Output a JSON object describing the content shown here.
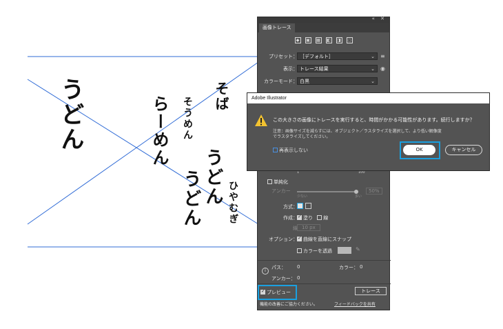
{
  "artboard": {
    "calligraphy": [
      "うどん",
      "そば",
      "らーめん",
      "うどん",
      "そうめん",
      "うどん",
      "ひやむぎ"
    ]
  },
  "panel": {
    "title_tab": "画像トレース",
    "preset_label": "プリセット：",
    "preset_value": "［デフォルト］",
    "view_label": "表示：",
    "view_value": "トレース結果",
    "mode_label": "カラーモード：",
    "mode_value": "白黒",
    "threshold_min": "1",
    "threshold_max": "100",
    "simplify_label": "単純化",
    "anchor_label": "アンカー",
    "anchor_value": "50%",
    "anchor_low": "少ない",
    "anchor_high": "多い",
    "method_label": "方式：",
    "create_label": "作成：",
    "fill_label": "塗り",
    "stroke_label": "線",
    "stroke_width_label": "線",
    "stroke_width_value": "10 px",
    "options_label": "オプション：",
    "snap_label": "曲線を直線にスナップ",
    "transparent_label": "カラーを透過",
    "paths_label": "パス：",
    "paths_value": "0",
    "colors_label": "カラー：",
    "colors_value": "0",
    "anchors_label": "アンカー：",
    "anchors_value": "0",
    "preview_label": "プレビュー",
    "trace_button": "トレース",
    "feedback_text": "機能の改善にご協力ください。",
    "feedback_link": "フィードバックを共有"
  },
  "dialog": {
    "title": "Adobe Illustrator",
    "message": "この大きさの画像にトレースを実行すると、時間がかかる可能性があります。続行しますか？",
    "note_line1": "注意：画像サイズを減らすには、オブジェクト／ラスタライズを選択して、より低い解像度",
    "note_line2": "でラスタライズしてください。",
    "dont_show": "再表示しない",
    "ok": "OK",
    "cancel": "キャンセル"
  },
  "colors": {
    "highlight": "#1aa0e0",
    "guide_line": "#2f6bd6",
    "panel_bg": "#535353"
  }
}
